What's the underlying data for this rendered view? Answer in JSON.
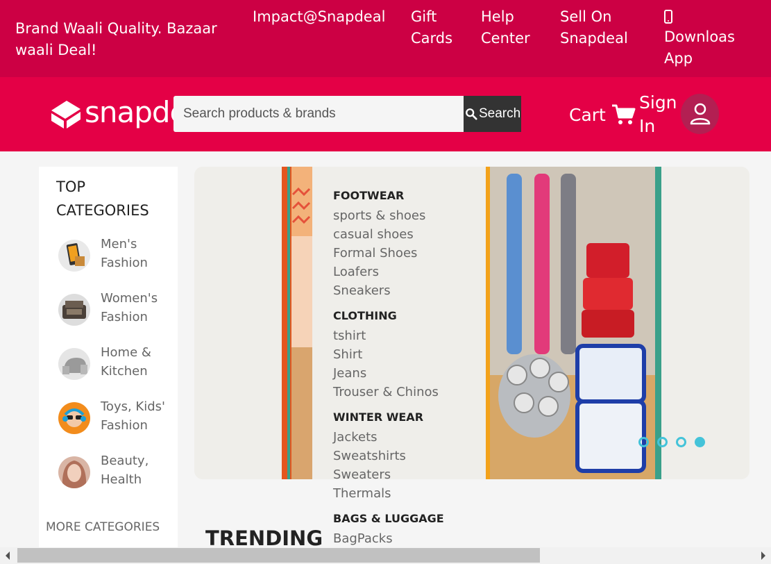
{
  "topbar": {
    "tagline": "Brand Waali Quality. Bazaar waali Deal!",
    "links": [
      "Impact@Snapdeal",
      "Gift Cards",
      "Help Center",
      "Sell On Snapdeal",
      "Downloas App"
    ]
  },
  "header": {
    "logo_text": "snapdeal",
    "search_placeholder": "Search products & brands",
    "search_label": "Search",
    "cart_label": "Cart",
    "signin_label": "Sign In"
  },
  "sidebar": {
    "title": "TOP CATEGORIES",
    "items": [
      {
        "label": "Men's Fashion"
      },
      {
        "label": "Women's Fashion"
      },
      {
        "label": "Home & Kitchen"
      },
      {
        "label": "Toys, Kids' Fashion"
      },
      {
        "label": "Beauty, Health"
      }
    ],
    "more": "MORE CATEGORIES"
  },
  "menu": [
    {
      "head": "FOOTWEAR",
      "items": [
        "sports & shoes",
        "casual shoes",
        "Formal Shoes",
        "Loafers",
        "Sneakers"
      ]
    },
    {
      "head": "CLOTHING",
      "items": [
        "tshirt",
        "Shirt",
        "Jeans",
        "Trouser & Chinos"
      ]
    },
    {
      "head": "WINTER WEAR",
      "items": [
        "Jackets",
        "Sweatshirts",
        "Sweaters",
        "Thermals"
      ]
    },
    {
      "head": "BAGS & LUGGAGE",
      "items": [
        "BagPacks"
      ]
    }
  ],
  "carousel": {
    "slide_count": 4,
    "active_index": 3
  },
  "section_title": "TRENDING",
  "colors": {
    "topbar": "#cc0044",
    "header": "#e40046",
    "search_button": "#333333",
    "dot": "#44c3d9"
  }
}
